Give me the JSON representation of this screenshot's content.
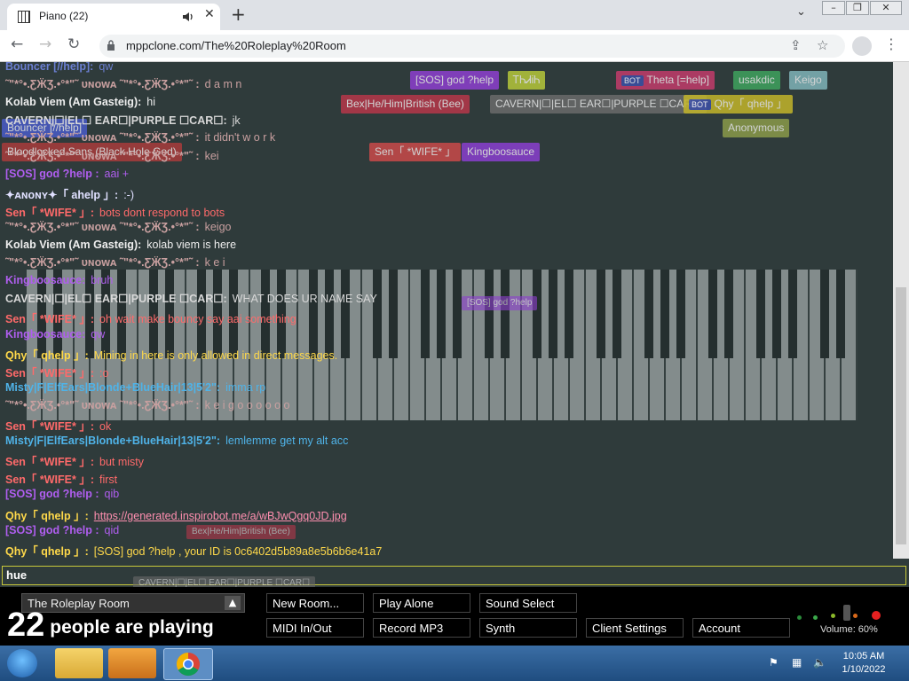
{
  "browser": {
    "tab_title": "Piano (22)",
    "url": "mppclone.com/The%20Roleplay%20Room",
    "new_tab_symbol": "+",
    "close_symbol": "✕",
    "icons": [
      "piano-favicon",
      "audio-icon",
      "close-icon",
      "plus-icon",
      "chevron-down-icon",
      "minimize-icon",
      "maximize-icon",
      "close-window-icon",
      "back-icon",
      "forward-icon",
      "reload-icon",
      "lock-icon",
      "share-icon",
      "star-icon",
      "profile-icon",
      "kebab-menu-icon"
    ]
  },
  "user_tags": [
    {
      "label": "[SOS] god ?help",
      "color": "#8e3fcf",
      "bot": false
    },
    {
      "label": "ᎢᏂᏗᎥᏂ",
      "color": "#b5c73a",
      "bot": false
    },
    {
      "label": "Theta [=help]",
      "color": "#c13b6a",
      "bot": true
    },
    {
      "label": "usakdic",
      "color": "#3fa25e",
      "bot": false
    },
    {
      "label": "Keigo",
      "color": "#7fb3b8",
      "bot": false
    },
    {
      "label": "Bex|He/Him|British (Bee)",
      "color": "#b7374a",
      "bot": false
    },
    {
      "label": "CAVERN|☐|EL☐ EAR☐|PURPLE ☐CAR☐",
      "color": "#6a6a6a",
      "bot": false
    },
    {
      "label": "Qhy「 qhelp 」",
      "color": "#c2b52a",
      "bot": true
    },
    {
      "label": "Anonymous",
      "color": "#8a9a4a",
      "bot": false
    },
    {
      "label": "Sen「 *WIFE* 」",
      "color": "#c94a4a",
      "bot": false
    },
    {
      "label": "Kingboosauce",
      "color": "#8a3fcf",
      "bot": false
    },
    {
      "label": "Bloodlocked Sans (Black Hole God)",
      "color": "#a83c3c",
      "bot": false
    },
    {
      "label": "Bouncer [//help]",
      "color": "#4a5bc7",
      "bot": false
    }
  ],
  "messages": [
    {
      "name": "Bouncer [//help]:",
      "text": "qw",
      "color": "#6b7fd1"
    },
    {
      "name": "˜\"*°•.ƸӜƷ.•°*\"˜ ᴜɴᴏᴡᴀ ˜\"*°•.ƸӜƷ.•°*\"˜ :",
      "text": "d a m n",
      "color": "#c9a0a0"
    },
    {
      "name": "Kolab Viem (Am Gasteig):",
      "text": "hi",
      "color": "#eeeeee"
    },
    {
      "name": "CAVERN|☐|EL☐ EAR☐|PURPLE ☐CAR☐:",
      "text": "jk",
      "color": "#d8d8d8"
    },
    {
      "name": "˜\"*°•.ƸӜƷ.•°*\"˜ ᴜɴᴏᴡᴀ ˜\"*°•.ƸӜƷ.•°*\"˜ :",
      "text": "it didn't w o r k",
      "color": "#c9a0a0"
    },
    {
      "name": "˜\"*°•.ƸӜƷ.•°*\"˜ ᴜɴᴏᴡᴀ ˜\"*°•.ƸӜƷ.•°*\"˜ :",
      "text": "kei",
      "color": "#c9a0a0"
    },
    {
      "name": "[SOS] god ?help :",
      "text": "aai +",
      "color": "#b05ef0"
    },
    {
      "name": "✦ᴀɴᴏɴʏ✦「 ahelp 」:",
      "text": ":-)",
      "color": "#e0e0ff"
    },
    {
      "name": "Sen「 *WIFE* 」:",
      "text": "bots dont respond to bots",
      "color": "#ff6a6a"
    },
    {
      "name": "˜\"*°•.ƸӜƷ.•°*\"˜ ᴜɴᴏᴡᴀ ˜\"*°•.ƸӜƷ.•°*\"˜ :",
      "text": "keigo",
      "color": "#c9a0a0"
    },
    {
      "name": "Kolab Viem (Am Gasteig):",
      "text": "kolab viem is here",
      "color": "#eeeeee"
    },
    {
      "name": "˜\"*°•.ƸӜƷ.•°*\"˜ ᴜɴᴏᴡᴀ ˜\"*°•.ƸӜƷ.•°*\"˜ :",
      "text": "k e i",
      "color": "#c9a0a0"
    },
    {
      "name": "Kingboosauce:",
      "text": "bruh",
      "color": "#b05ef0"
    },
    {
      "name": "CAVERN|☐|EL☐ EAR☐|PURPLE ☐CAR☐:",
      "text": "WHAT DOES UR NAME SAY",
      "color": "#d8d8d8"
    },
    {
      "name": "Sen「 *WIFE* 」:",
      "text": "oh wait make bouncy say aai something",
      "color": "#ff6a6a"
    },
    {
      "name": "Kingboosauce:",
      "text": "qw",
      "color": "#b05ef0"
    },
    {
      "name": "Qhy「 qhelp 」:",
      "text": "Mining in here is only allowed in direct messages.",
      "color": "#ffd94a"
    },
    {
      "name": "Sen「 *WIFE* 」:",
      "text": ":o",
      "color": "#ff6a6a"
    },
    {
      "name": "Misty|F|ElfEars|Blonde+BlueHair|13|5'2\":",
      "text": "imma rp",
      "color": "#4fb3e8"
    },
    {
      "name": "˜\"*°•.ƸӜƷ.•°*\"˜ ᴜɴᴏᴡᴀ ˜\"*°•.ƸӜƷ.•°*\"˜ :",
      "text": "k e i g o o o o o o",
      "color": "#c9a0a0"
    },
    {
      "name": "Sen「 *WIFE* 」:",
      "text": "ok",
      "color": "#ff6a6a"
    },
    {
      "name": "Misty|F|ElfEars|Blonde+BlueHair|13|5'2\":",
      "text": "lemlemme get my alt acc",
      "color": "#4fb3e8"
    },
    {
      "name": "Sen「 *WIFE* 」:",
      "text": "but misty",
      "color": "#ff6a6a"
    },
    {
      "name": "Sen「 *WIFE* 」:",
      "text": "first",
      "color": "#ff6a6a"
    },
    {
      "name": "[SOS] god ?help :",
      "text": "qib",
      "color": "#b05ef0"
    },
    {
      "name": "Qhy「 qhelp 」:",
      "text": "https://generated.inspirobot.me/a/wBJwQgq0JD.jpg",
      "color": "#ffd94a",
      "link": true
    },
    {
      "name": "[SOS] god ?help :",
      "text": "qid",
      "color": "#b05ef0"
    },
    {
      "name": "Qhy「 qhelp 」:",
      "text": "[SOS] god ?help , your ID is 0c6402d5b89a8e5b6b6e41a7",
      "color": "#ffd94a"
    }
  ],
  "floating_labels": [
    {
      "label": "[SOS] god ?help",
      "color": "#8e3fcf"
    },
    {
      "label": "Bex|He/Him|British (Bee)",
      "color": "#b7374a"
    },
    {
      "label": "CAVERN|☐|EL☐ EAR☐|PURPLE ☐CAR☐",
      "color": "#6a6a6a"
    }
  ],
  "chat_input": {
    "value": "hue"
  },
  "room": {
    "name": "The Roleplay Room",
    "arrow": "▲"
  },
  "playing": {
    "count": "22",
    "suffix": "people are playing"
  },
  "buttons": {
    "new_room": "New Room...",
    "play_alone": "Play Alone",
    "sound_select": "Sound Select",
    "midi": "MIDI In/Out",
    "record": "Record MP3",
    "synth": "Synth",
    "client_settings": "Client Settings",
    "account": "Account"
  },
  "volume": {
    "label": "Volume: 60%",
    "level": 0.6
  },
  "taskbar": {
    "time": "10:05 AM",
    "date": "1/10/2022"
  },
  "colors": {
    "page_bg": "#2f3b3b",
    "input_border": "#c8c83a",
    "bottom_bg": "#000000"
  }
}
